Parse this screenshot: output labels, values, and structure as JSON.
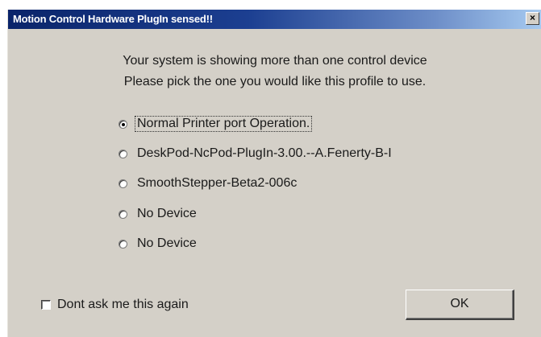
{
  "dialog": {
    "title": "Motion Control Hardware PlugIn sensed!!",
    "close_glyph": "×",
    "message_line1": "Your system is showing more than one control device",
    "message_line2": "Please pick the one you would like this profile to use.",
    "options": [
      {
        "label": "Normal Printer port Operation.",
        "selected": true
      },
      {
        "label": "DeskPod-NcPod-PlugIn-3.00.--A.Fenerty-B-I",
        "selected": false
      },
      {
        "label": "SmoothStepper-Beta2-006c",
        "selected": false
      },
      {
        "label": "No Device",
        "selected": false
      },
      {
        "label": "No Device",
        "selected": false
      }
    ],
    "dont_ask_label": "Dont ask me this again",
    "dont_ask_checked": false,
    "ok_label": "OK"
  },
  "colors": {
    "dialog_face": "#d4d0c8",
    "titlebar_start": "#0a246a",
    "titlebar_end": "#a6caf0",
    "title_text": "#ffffff"
  }
}
